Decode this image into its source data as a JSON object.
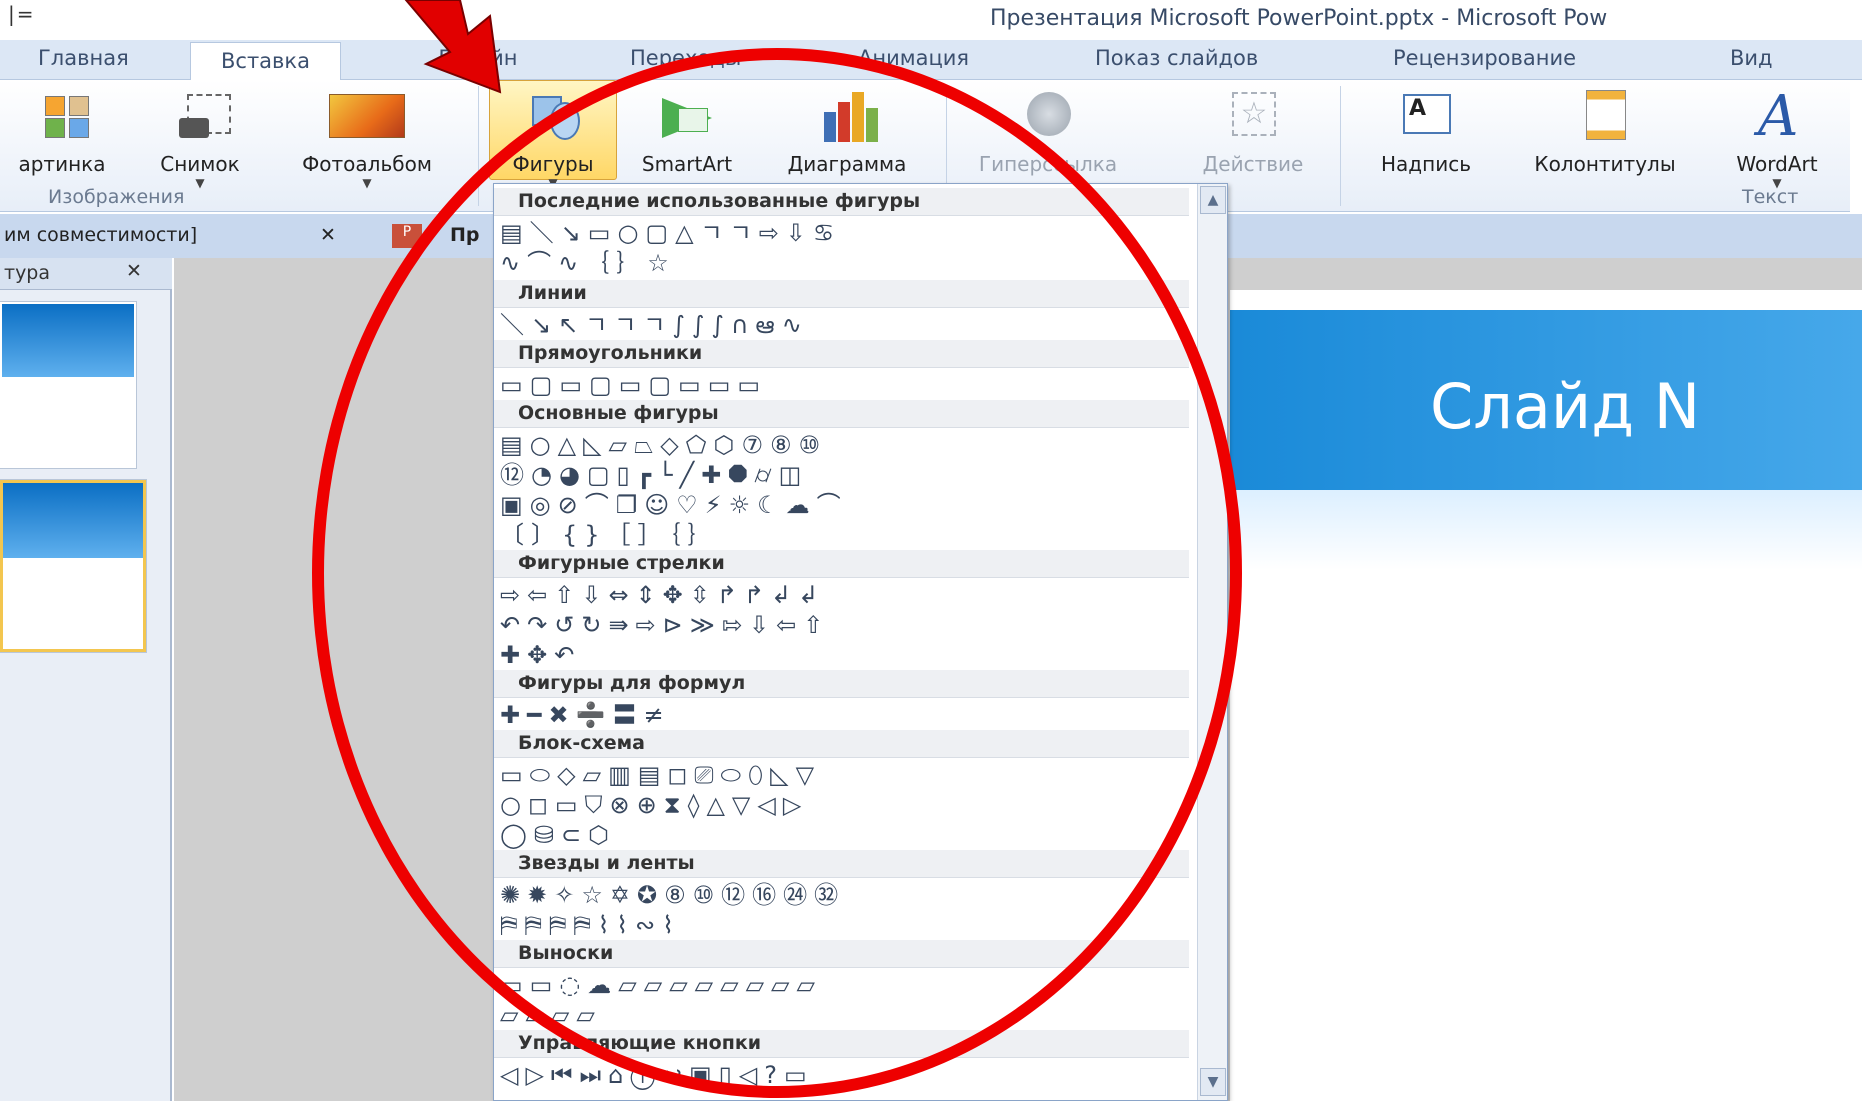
{
  "window": {
    "qat": "|=",
    "title": "Презентация Microsoft PowerPoint.pptx - Microsoft Pow"
  },
  "tabs": [
    "Главная",
    "Вставка",
    "Дизайн",
    "Переходы",
    "Анимация",
    "Показ слайдов",
    "Рецензирование",
    "Вид"
  ],
  "ribbon": {
    "buttons": [
      "артинка",
      "Снимок",
      "Фотоальбом",
      "Фигуры",
      "SmartArt",
      "Диаграмма",
      "Гиперссылка",
      "Действие",
      "Надпись",
      "Колонтитулы",
      "WordArt"
    ],
    "groups": [
      "Изображения",
      "Текст"
    ]
  },
  "doc_tabs": [
    "им совместимости]",
    "Пр"
  ],
  "left_pane": {
    "header": "тура"
  },
  "slide": {
    "title": "Слайд N"
  },
  "shapes_menu": {
    "sections": [
      {
        "title": "Последние использованные фигуры",
        "rows": [
          "▤＼↘▭○▢△ㄱㄱ⇨⇩♋",
          "∿⌒∿｛｝☆"
        ]
      },
      {
        "title": "Линии",
        "rows": [
          "＼↘↖ㄱㄱㄱ∫∫∫∩ఆ∿"
        ]
      },
      {
        "title": "Прямоугольники",
        "rows": [
          "▭▢▭▢▭▢▭▭▭"
        ]
      },
      {
        "title": "Основные фигуры",
        "rows": [
          "▤○△◺▱⏢◇⬠⬡⑦⑧⑩",
          "⑫◔◕▢▯┏└╱✚⯃⌭◫",
          "▣◎⊘⌒❐☺♡⚡☼☾☁⌒",
          "〔〕{}［］｛｝"
        ]
      },
      {
        "title": "Фигурные стрелки",
        "rows": [
          "⇨⇦⇧⇩⇔⇕✥⇳↱↱↲↲",
          "↶↷↺↻⇛⇨⊳≫⇰⇩⇦⇧",
          "✚✥↶"
        ]
      },
      {
        "title": "Фигуры для формул",
        "rows": [
          "✚━✖➗〓≠"
        ]
      },
      {
        "title": "Блок-схема",
        "rows": [
          "▭⬭◇▱▥▤◻⎚⬭⬯◺▽",
          "○◻▭⛉⊗⊕⧗◊△▽◁▷",
          "◯⛁⊂⬡"
        ]
      },
      {
        "title": "Звезды и ленты",
        "rows": [
          "✺✹✧☆✡✪⑧⑩⑫⑯㉔㉜",
          "⛿⛿⛿⛿⌇⌇∾⌇"
        ]
      },
      {
        "title": "Выноски",
        "rows": [
          "▭▭◌☁▱▱▱▱▱▱▱▱",
          "▱▱▱▱"
        ]
      },
      {
        "title": "Управляющие кнопки",
        "rows": [
          "◁▷⏮⏭⌂ⓘ↩▣▯◁?▭"
        ]
      }
    ]
  },
  "colors": {
    "highlight": "#ff0000",
    "ribbon_tab": "#dce7f5",
    "accent": "#1a8ad8"
  }
}
